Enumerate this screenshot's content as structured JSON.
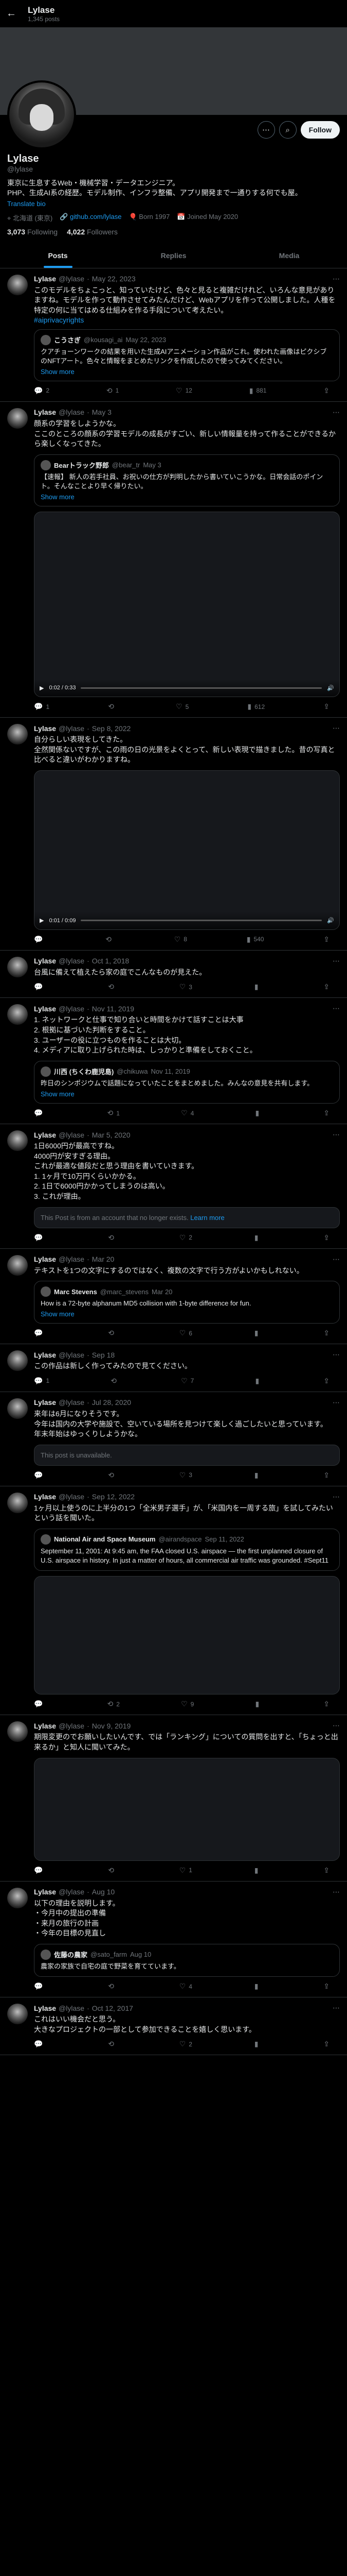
{
  "topbar": {
    "name": "Lylase",
    "sub": "1,345 posts"
  },
  "profile": {
    "name": "Lylase",
    "handle": "@lylase",
    "bio": "東京に生息するWeb・機械学習・データエンジニア。\nPHP、生成AI系の経歴。モデル制作、インフラ整備、アプリ開発まで一通りする何でも屋。",
    "bio_link": "Translate bio",
    "location": "北海道 (東京)",
    "link": "github.com/lylase",
    "born": "Born 1997",
    "joined": "Joined May 2020",
    "following_count": "3,073",
    "following_label": "Following",
    "followers_count": "4,022",
    "followers_label": "Followers",
    "follow_button": "Follow"
  },
  "tabs": [
    "Posts",
    "Replies",
    "Media"
  ],
  "tweets": [
    {
      "date": "May 22, 2023",
      "text": "このモデルをちょこっと、知っていたけど、色々と見ると複雑だけれど、いろんな意見がありますね。モデルを作って動作させてみたんだけど、Webアプリを作って公開しました。人種を特定の何に当てはめる仕組みを作る手段について考えたい。",
      "quote": {
        "name": "こうさぎ",
        "handle": "@kousagi_ai",
        "date": "May 22, 2023",
        "text": "クアチョーンワークの結果を用いた生成AIアニメーション作品がこれ。使われた画像はピクシブのNFTアート。色々と情報をまとめたリンクを作成したので使ってみてください。",
        "more": "Show more"
      },
      "hashtag": "#aiprivacyrights",
      "replies": "2",
      "reposts": "1",
      "likes": "12",
      "views": "881"
    },
    {
      "date": "May 3",
      "text": "顔系の学習をしようかな。\nここのところの顔系の学習モデルの成長がすごい、新しい情報量を持って作ることができるから楽しくなってきた。",
      "quote": {
        "name": "Bearトラック野郎",
        "handle": "@bear_tr",
        "date": "May 3",
        "text": "【速報】 新人の若手社員、お祝いの仕方が判明したから書いていこうかな。日常会話のポイント。そんなことより早く帰りたい。",
        "more": "Show more"
      },
      "video_time": "0:02 / 0:33",
      "replies": "1",
      "reposts": "",
      "likes": "5",
      "views": "612"
    },
    {
      "date": "Sep 8, 2022",
      "text": "自分らしい表現をしてきた。\n全然関係ないですが、この雨の日の光景をよくとって、新しい表現で描きました。昔の写真と比べると違いがわかりますね。",
      "video_time": "0:01 / 0:09",
      "replies": "",
      "reposts": "",
      "likes": "8",
      "views": "540"
    },
    {
      "date": "Oct 1, 2018",
      "text": "台風に備えて植えたら家の庭でこんなものが見えた。",
      "replies": "",
      "reposts": "",
      "likes": "3",
      "views": ""
    },
    {
      "date": "Nov 11, 2019",
      "text": "1. ネットワークと仕事で知り合いと時間をかけて話すことは大事\n2. 根拠に基づいた判断をすること。\n3. ユーザーの役に立つものを作ることは大切。\n4. メディアに取り上げられた時は、しっかりと準備をしておくこと。",
      "quote": {
        "name": "川西 (ちくわ鹿児島)",
        "handle": "@chikuwa",
        "date": "Nov 11, 2019",
        "text": "昨日のシンポジウムで話題になっていたことをまとめました。みんなの意見を共有します。",
        "more": "Show more"
      },
      "replies": "",
      "reposts": "1",
      "likes": "4",
      "views": ""
    },
    {
      "date": "Mar 5, 2020",
      "text": "1日6000円が最高ですね。\n4000円が安すぎる理由。\nこれが最適な値段だと思う理由を書いていきます。\n1. 1ヶ月で10万円くらいかかる。\n2. 1日で6000円かかってしまうのは高い。\n3. これが理由。",
      "unavailable": "This Post is from an account that no longer exists.",
      "learn_more": "Learn more",
      "replies": "",
      "reposts": "",
      "likes": "2",
      "views": ""
    },
    {
      "date": "Mar 20",
      "text": "テキストを1つの文字にするのではなく、複数の文字で行う方がよいかもしれない。",
      "quote": {
        "name": "Marc Stevens",
        "handle": "@marc_stevens",
        "date": "Mar 20",
        "text": "How is a 72-byte alphanum MD5 collision with 1-byte difference for fun.",
        "more": "Show more"
      },
      "replies": "",
      "reposts": "",
      "likes": "6",
      "views": ""
    },
    {
      "date": "Sep 18",
      "text": "この作品は新しく作ってみたので見てください。",
      "replies": "1",
      "reposts": "",
      "likes": "7",
      "views": ""
    },
    {
      "date": "Jul 28, 2020",
      "text": "来年は6月になりそうです。\n今年は国内の大学や施設で、空いている場所を見つけて楽しく過ごしたいと思っています。\n年末年始はゆっくりしようかな。",
      "unavailable": "This post is unavailable.",
      "replies": "",
      "reposts": "",
      "likes": "3",
      "views": ""
    },
    {
      "date": "Sep 12, 2022",
      "text": "1ヶ月以上使うのに上半分の1つ「全米男子選手」が、「米国内を一周する旅」を試してみたいという話を聞いた。",
      "quote": {
        "name": "National Air and Space Museum",
        "handle": "@airandspace",
        "date": "Sep 11, 2022",
        "text": "September 11, 2001: At 9:45 am, the FAA closed U.S. airspace — the first unplanned closure of U.S. airspace in history. In just a matter of hours, all commercial air traffic was grounded. #Sept11",
        "more": ""
      },
      "replies": "",
      "reposts": "2",
      "likes": "9",
      "views": ""
    },
    {
      "date": "Nov 9, 2019",
      "text": "期限変更のでお願いしたいんです、では「ランキング」についての質問を出すと、「ちょっと出来るか」と知人に聞いてみた。",
      "replies": "",
      "reposts": "",
      "likes": "1",
      "views": ""
    },
    {
      "date": "Aug 10",
      "text": "以下の理由を説明します。\n・今月中の提出の準備\n・来月の旅行の計画\n・今年の目標の見直し",
      "quote": {
        "name": "佐藤の農家",
        "handle": "@sato_farm",
        "date": "Aug 10",
        "text": "農家の家族で自宅の庭で野菜を育てています。",
        "more": ""
      },
      "replies": "",
      "reposts": "",
      "likes": "4",
      "views": ""
    },
    {
      "date": "Oct 12, 2017",
      "text": "これはいい機会だと思う。\n大きなプロジェクトの一部として参加できることを嬉しく思います。",
      "replies": "",
      "reposts": "",
      "likes": "2",
      "views": ""
    }
  ],
  "author": {
    "name": "Lylase",
    "handle": "@lylase"
  }
}
